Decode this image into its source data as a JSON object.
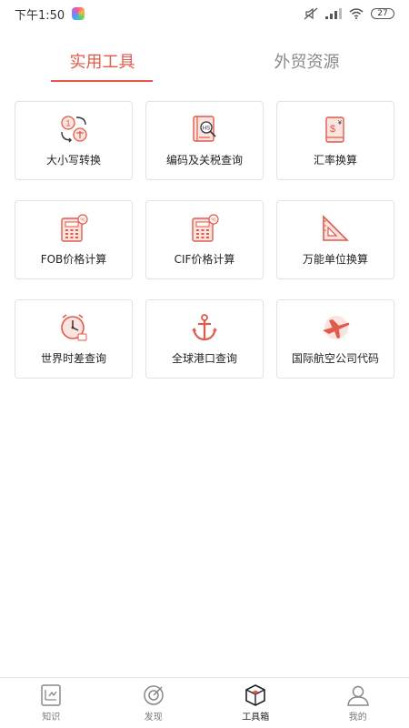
{
  "status_bar": {
    "time": "下午1:50",
    "battery": "27"
  },
  "tabs": [
    {
      "label": "实用工具",
      "active": true
    },
    {
      "label": "外贸资源",
      "active": false
    }
  ],
  "tools": [
    {
      "label": "大小写转换",
      "icon": "number-convert-icon"
    },
    {
      "label": "编码及关税查询",
      "icon": "hs-code-book-icon"
    },
    {
      "label": "汇率换算",
      "icon": "exchange-rate-icon"
    },
    {
      "label": "FOB价格计算",
      "icon": "calculator-icon"
    },
    {
      "label": "CIF价格计算",
      "icon": "calculator-icon"
    },
    {
      "label": "万能单位换算",
      "icon": "ruler-triangle-icon"
    },
    {
      "label": "世界时差查询",
      "icon": "world-clock-icon"
    },
    {
      "label": "全球港口查询",
      "icon": "anchor-icon"
    },
    {
      "label": "国际航空公司代码",
      "icon": "airplane-icon"
    }
  ],
  "bottom_nav": [
    {
      "label": "知识",
      "icon": "knowledge-icon",
      "active": false
    },
    {
      "label": "发现",
      "icon": "discover-icon",
      "active": false
    },
    {
      "label": "工具箱",
      "icon": "toolbox-icon",
      "active": true
    },
    {
      "label": "我的",
      "icon": "profile-icon",
      "active": false
    }
  ],
  "colors": {
    "accent": "#e05a4a",
    "border": "#e2e2e2",
    "text": "#222222",
    "muted": "#888888"
  }
}
